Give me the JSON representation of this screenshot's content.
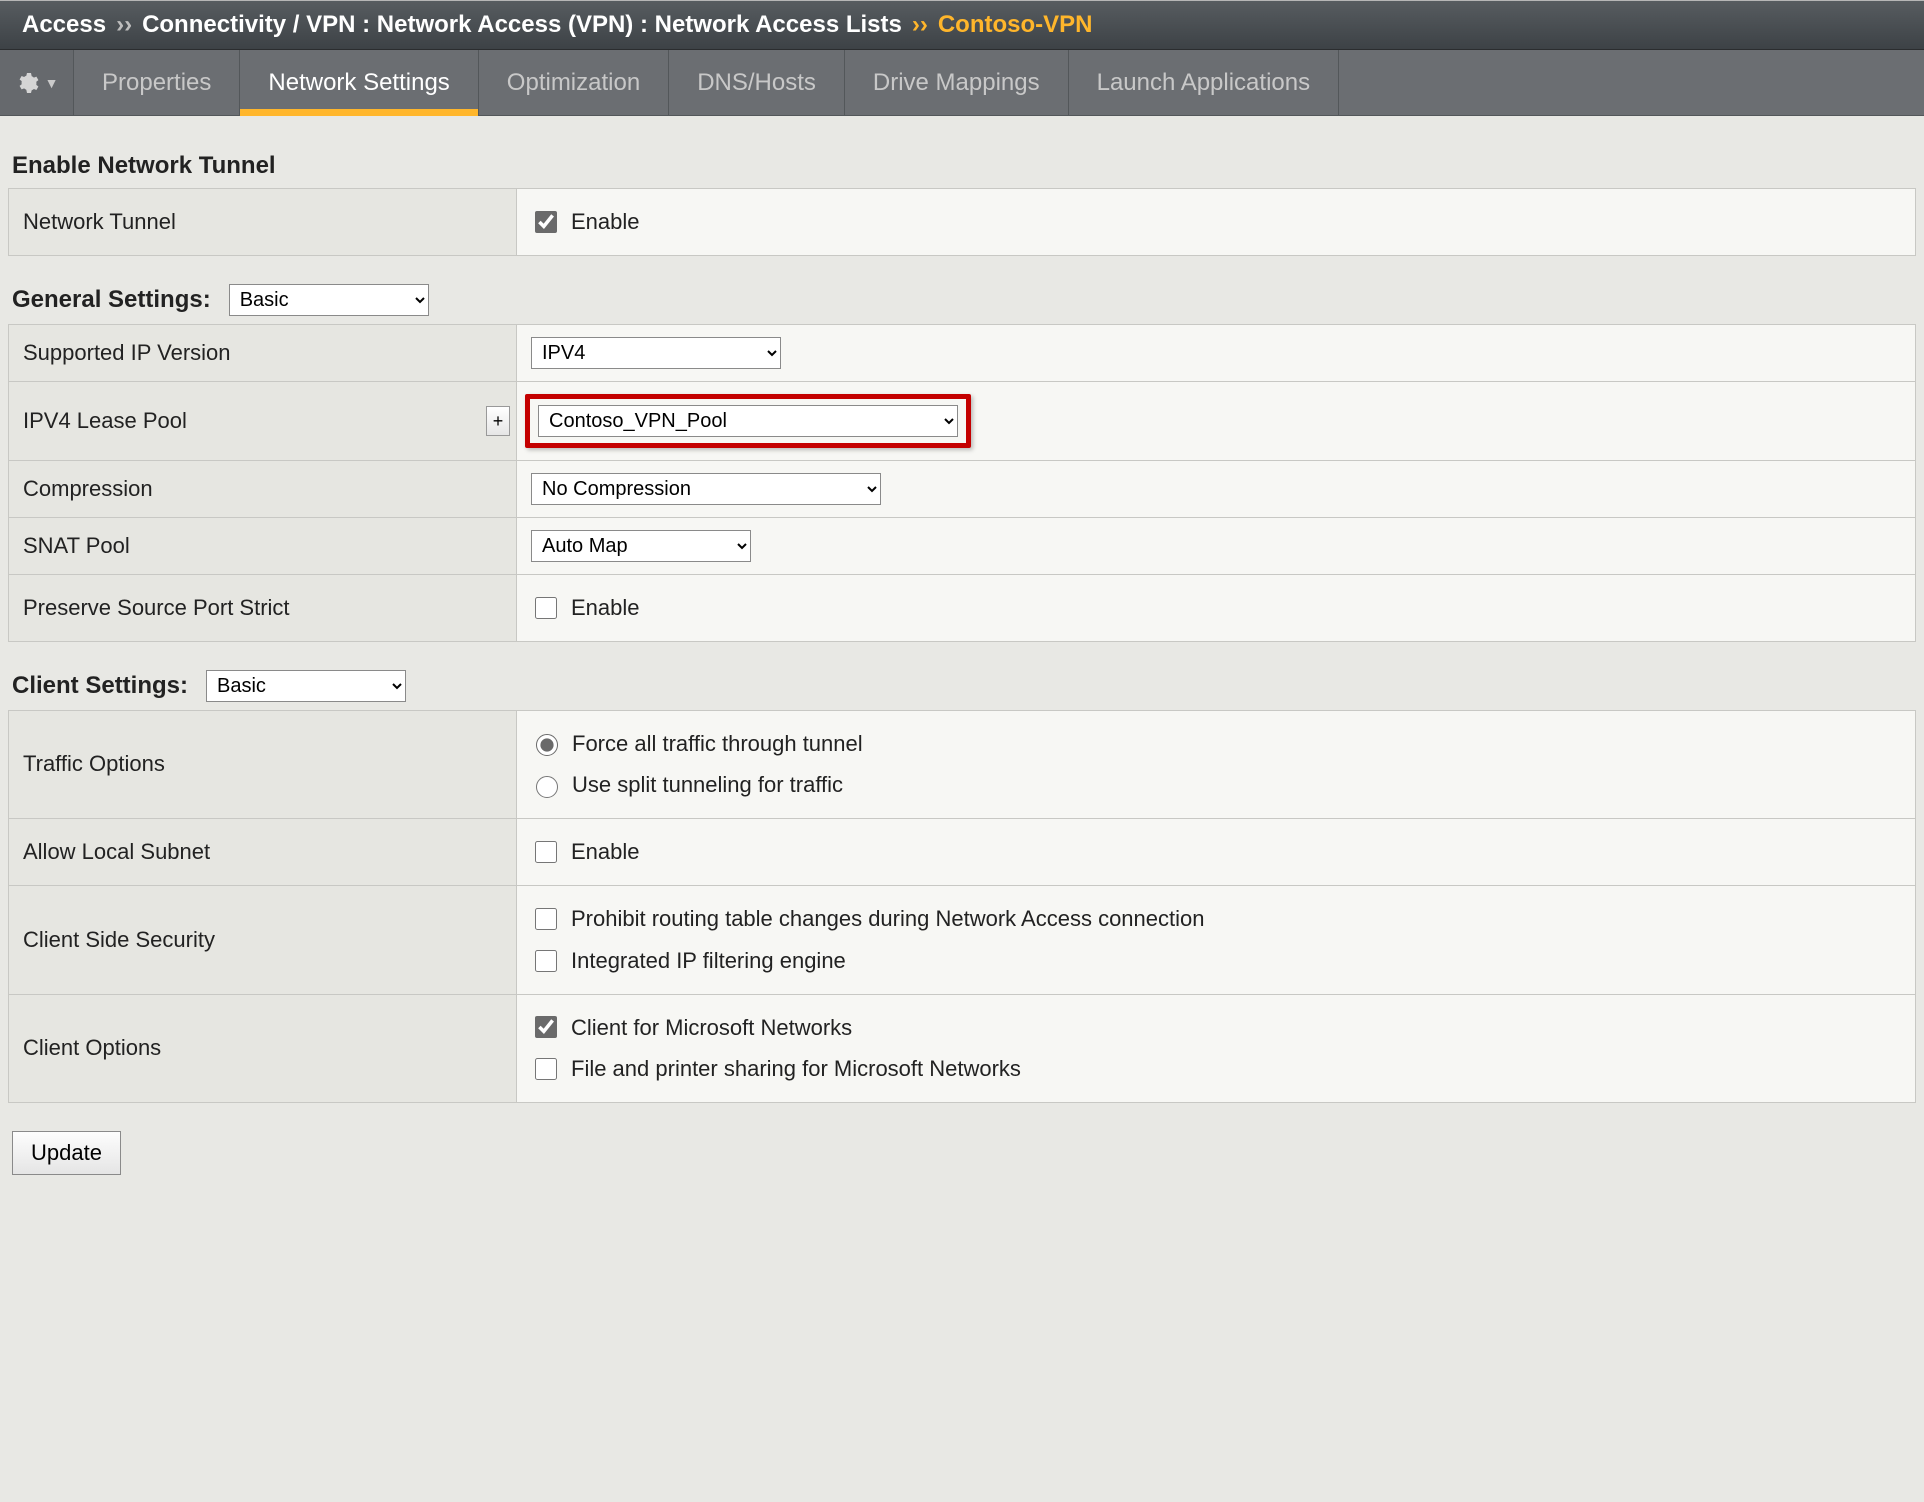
{
  "breadcrumb": {
    "root": "Access",
    "path": "Connectivity / VPN : Network Access (VPN) : Network Access Lists",
    "current": "Contoso-VPN",
    "sep": "››"
  },
  "tabs": [
    {
      "label": "Properties"
    },
    {
      "label": "Network Settings",
      "active": true
    },
    {
      "label": "Optimization"
    },
    {
      "label": "DNS/Hosts"
    },
    {
      "label": "Drive Mappings"
    },
    {
      "label": "Launch Applications"
    }
  ],
  "sections": {
    "enable_tunnel": {
      "title": "Enable Network Tunnel",
      "rows": {
        "network_tunnel": {
          "label": "Network Tunnel",
          "checkbox_label": "Enable",
          "checked": true
        }
      }
    },
    "general": {
      "title": "General Settings:",
      "mode_options": [
        "Basic"
      ],
      "mode_selected": "Basic",
      "rows": {
        "ip_version": {
          "label": "Supported IP Version",
          "options": [
            "IPV4"
          ],
          "selected": "IPV4"
        },
        "lease_pool": {
          "label": "IPV4 Lease Pool",
          "add_button": "+",
          "options": [
            "Contoso_VPN_Pool"
          ],
          "selected": "Contoso_VPN_Pool",
          "highlight": true
        },
        "compression": {
          "label": "Compression",
          "options": [
            "No Compression"
          ],
          "selected": "No Compression"
        },
        "snat_pool": {
          "label": "SNAT Pool",
          "options": [
            "Auto Map"
          ],
          "selected": "Auto Map"
        },
        "preserve_src": {
          "label": "Preserve Source Port Strict",
          "checkbox_label": "Enable",
          "checked": false
        }
      }
    },
    "client": {
      "title": "Client Settings:",
      "mode_options": [
        "Basic"
      ],
      "mode_selected": "Basic",
      "rows": {
        "traffic_options": {
          "label": "Traffic Options",
          "radios": [
            {
              "label": "Force all traffic through tunnel",
              "checked": true
            },
            {
              "label": "Use split tunneling for traffic",
              "checked": false
            }
          ]
        },
        "allow_local": {
          "label": "Allow Local Subnet",
          "checkbox_label": "Enable",
          "checked": false
        },
        "client_security": {
          "label": "Client Side Security",
          "boxes": [
            {
              "label": "Prohibit routing table changes during Network Access connection",
              "checked": false
            },
            {
              "label": "Integrated IP filtering engine",
              "checked": false
            }
          ]
        },
        "client_options": {
          "label": "Client Options",
          "boxes": [
            {
              "label": "Client for Microsoft Networks",
              "checked": true
            },
            {
              "label": "File and printer sharing for Microsoft Networks",
              "checked": false
            }
          ]
        }
      }
    }
  },
  "buttons": {
    "update": "Update"
  }
}
